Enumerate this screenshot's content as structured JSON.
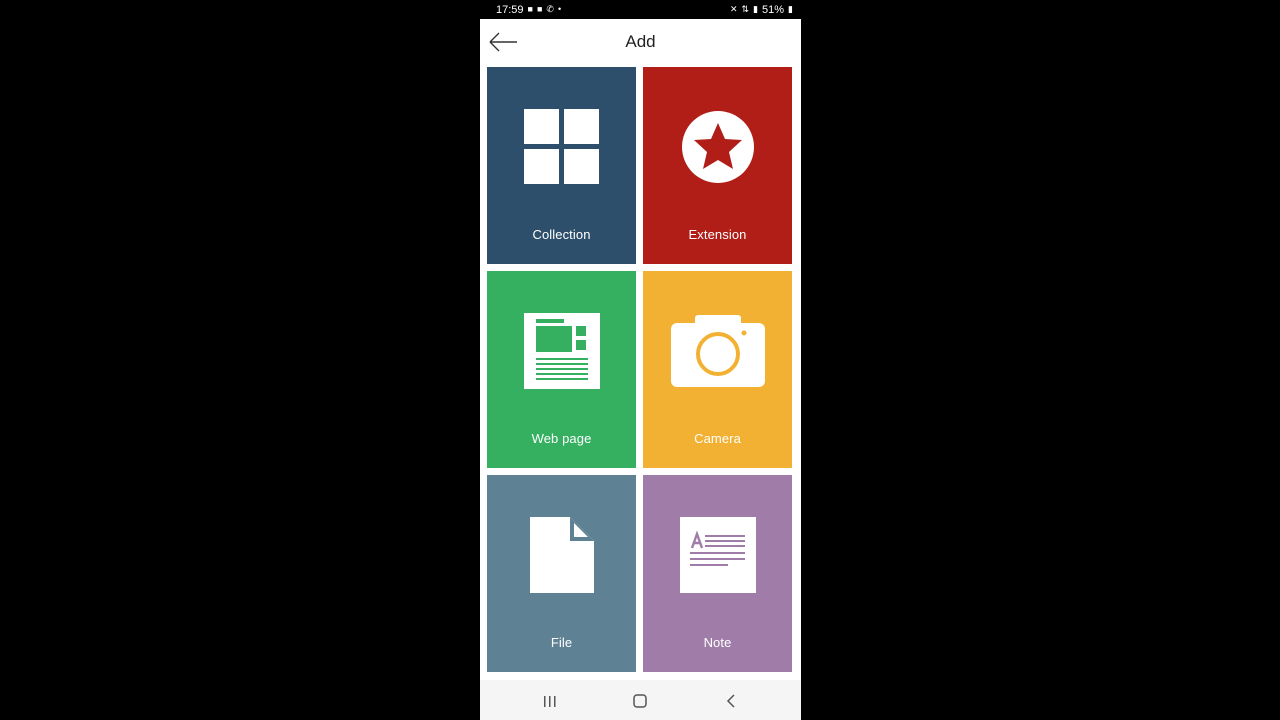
{
  "status": {
    "time": "17:59",
    "left_icons": [
      "video-icon",
      "video-icon",
      "call-icon",
      "dot-icon"
    ],
    "battery": "51%",
    "right_icons": [
      "mute-icon",
      "data-icon",
      "signal-icon",
      "battery-icon"
    ]
  },
  "app_bar": {
    "title": "Add",
    "back_icon": "arrow-left-icon"
  },
  "tiles": [
    {
      "label": "Collection",
      "color": "#2d4f6c",
      "icon": "grid-icon"
    },
    {
      "label": "Extension",
      "color": "#b01e17",
      "icon": "star-icon"
    },
    {
      "label": "Web page",
      "color": "#35b061",
      "icon": "webpage-icon"
    },
    {
      "label": "Camera",
      "color": "#f2b132",
      "icon": "camera-icon"
    },
    {
      "label": "File",
      "color": "#5e8193",
      "icon": "file-icon"
    },
    {
      "label": "Note",
      "color": "#a07ca8",
      "icon": "note-icon"
    }
  ],
  "nav": {
    "icons": [
      "recents-icon",
      "home-icon",
      "back-icon"
    ]
  }
}
